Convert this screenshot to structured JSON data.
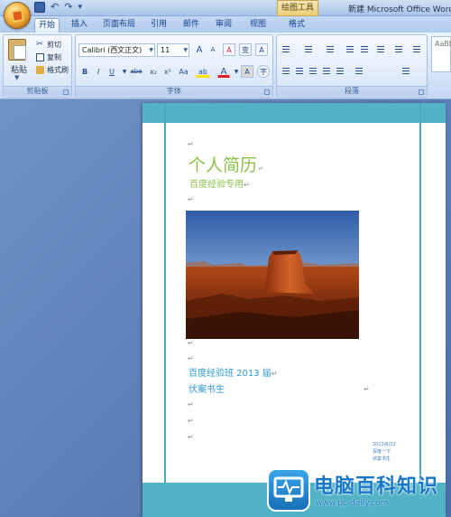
{
  "window": {
    "title": "新建 Microsoft Office Word",
    "context_tab": "绘图工具"
  },
  "quick_access": {
    "undo": "↶",
    "redo": "↷",
    "customize": "▾"
  },
  "tabs": [
    {
      "label": "开始",
      "active": true
    },
    {
      "label": "插入"
    },
    {
      "label": "页面布局"
    },
    {
      "label": "引用"
    },
    {
      "label": "邮件"
    },
    {
      "label": "审阅"
    },
    {
      "label": "视图"
    },
    {
      "label": "格式"
    }
  ],
  "clipboard": {
    "paste": "粘贴",
    "cut": "剪切",
    "copy": "复制",
    "format_painter": "格式刷",
    "group_label": "剪贴板"
  },
  "font": {
    "name": "Calibri (西文正文)",
    "size": "11",
    "grow": "A",
    "shrink": "A",
    "clear": "A",
    "phonetic": "变",
    "border_char": "A",
    "bold": "B",
    "italic": "I",
    "underline": "U",
    "strike": "abe",
    "subscript": "x₂",
    "superscript": "x²",
    "case": "Aa",
    "highlight": "ab",
    "font_color": "A",
    "shading": "A",
    "enclose": "字",
    "group_label": "字体"
  },
  "paragraph": {
    "group_label": "段落"
  },
  "styles": {
    "preview": "AaBb"
  },
  "document": {
    "title": "个人简历",
    "subtitle": "百度经验专用",
    "class_line": "百度经验班 2013 届",
    "name_line": "伏案书生",
    "textbox_lines": [
      "2013/6/22",
      "百度一下",
      "伏案书生"
    ],
    "pilcrow": "↵"
  },
  "watermark": {
    "name": "电脑百科知识",
    "url": "www.pc-daily.com"
  },
  "colors": {
    "accent_teal": "#52b3c7",
    "title_green": "#8cc24b",
    "body_blue": "#2f9bd3"
  }
}
